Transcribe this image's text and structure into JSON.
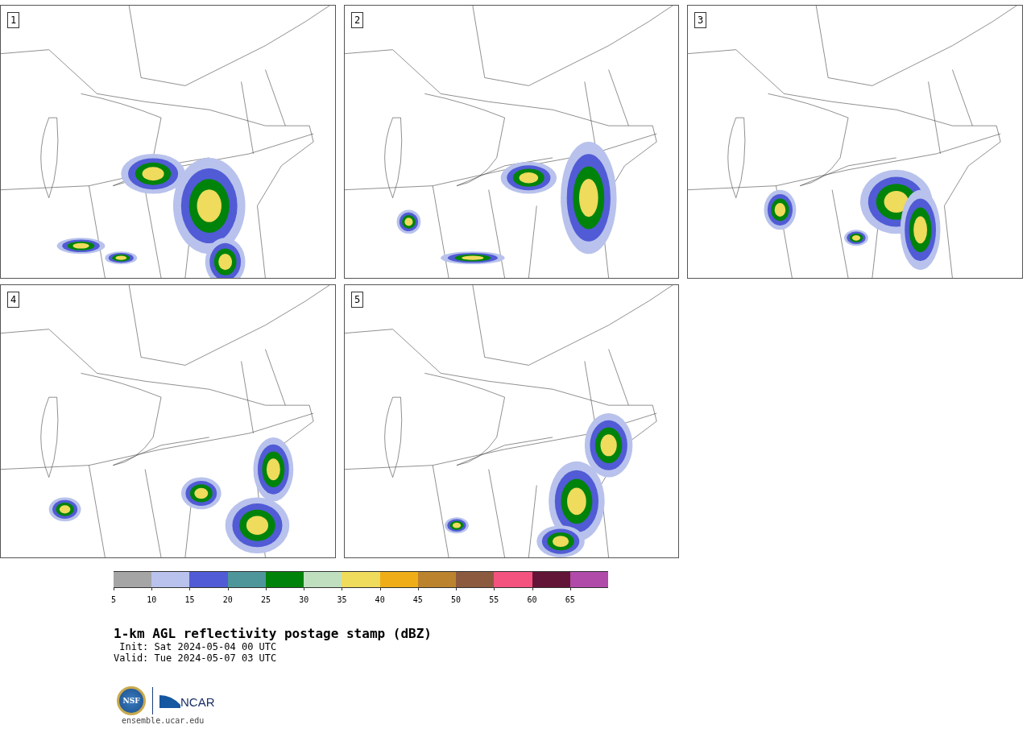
{
  "panels": [
    {
      "label": "1"
    },
    {
      "label": "2"
    },
    {
      "label": "3"
    },
    {
      "label": "4"
    },
    {
      "label": "5"
    }
  ],
  "colorbar": {
    "segments": [
      {
        "color": "#a5a5a5"
      },
      {
        "color": "#b8c2ec"
      },
      {
        "color": "#515bd5"
      },
      {
        "color": "#4e9699"
      },
      {
        "color": "#00830b"
      },
      {
        "color": "#bfdfbf"
      },
      {
        "color": "#efdb5c"
      },
      {
        "color": "#efae17"
      },
      {
        "color": "#bc832e"
      },
      {
        "color": "#8c5a3f"
      },
      {
        "color": "#f4527f"
      },
      {
        "color": "#631537"
      },
      {
        "color": "#b04ba9"
      }
    ],
    "ticks": [
      "5",
      "10",
      "15",
      "20",
      "25",
      "30",
      "35",
      "40",
      "45",
      "50",
      "55",
      "60",
      "65"
    ]
  },
  "title": "1-km AGL reflectivity postage stamp (dBZ)",
  "init": " Init: Sat 2024-05-04 00 UTC",
  "valid": "Valid: Tue 2024-05-07 03 UTC",
  "logo": {
    "left": "NSF",
    "right": "NCAR"
  },
  "url": "ensemble.ucar.edu"
}
